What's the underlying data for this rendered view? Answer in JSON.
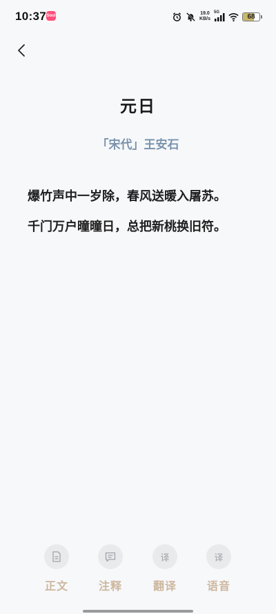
{
  "status_bar": {
    "time": "10:37",
    "app_badge": "Soul",
    "net_speed_value": "19.0",
    "net_speed_unit": "KB/s",
    "network": "5G",
    "battery": "68",
    "battery_level_percent": 68,
    "battery_color": "#c9b76a"
  },
  "poem": {
    "title": "元日",
    "author": "「宋代」王安石",
    "lines": [
      "爆竹声中一岁除，春风送暖入屠苏。",
      "千门万户曈曈日，总把新桃换旧符。"
    ]
  },
  "tabs": [
    {
      "label": "正文",
      "icon": "document-icon"
    },
    {
      "label": "注释",
      "icon": "comment-icon"
    },
    {
      "label": "翻译",
      "icon": "translate-icon",
      "glyph": "译"
    },
    {
      "label": "语音",
      "icon": "translate-icon",
      "glyph": "译"
    }
  ],
  "colors": {
    "background": "#f7f8fa",
    "author": "#7a93ad",
    "tab_label": "#cdb79e",
    "tab_circle": "#e9eaec"
  }
}
